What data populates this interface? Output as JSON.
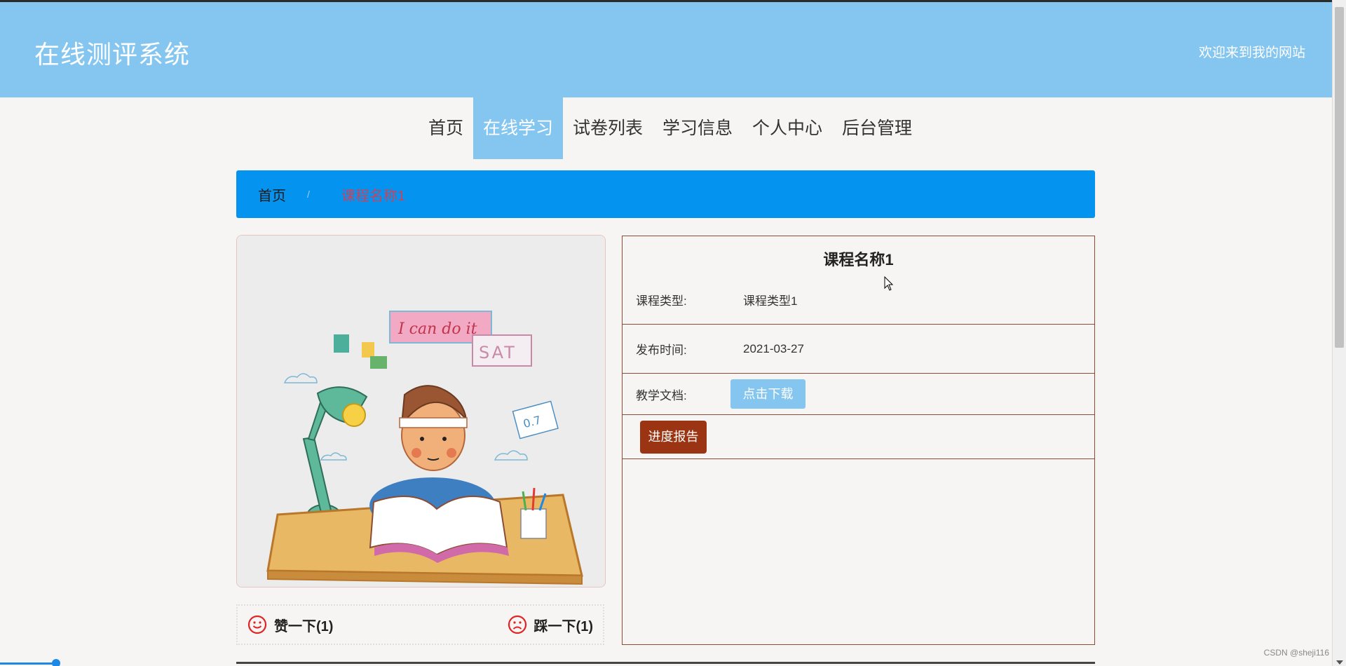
{
  "header": {
    "site_title": "在线测评系统",
    "welcome": "欢迎来到我的网站"
  },
  "nav": {
    "items": [
      {
        "label": "首页",
        "active": false
      },
      {
        "label": "在线学习",
        "active": true
      },
      {
        "label": "试卷列表",
        "active": false
      },
      {
        "label": "学习信息",
        "active": false
      },
      {
        "label": "个人中心",
        "active": false
      },
      {
        "label": "后台管理",
        "active": false
      }
    ]
  },
  "breadcrumb": {
    "home": "首页",
    "separator": "/",
    "current": "课程名称1"
  },
  "image": {
    "banner_text": "I can do it",
    "tag_text": "SAT",
    "paper_text": "0.7"
  },
  "votes": {
    "like": "赞一下(1)",
    "dislike": "踩一下(1)"
  },
  "detail": {
    "title": "课程名称1",
    "type_label": "课程类型:",
    "type_value": "课程类型1",
    "time_label": "发布时间:",
    "time_value": "2021-03-27",
    "doc_label": "教学文档:",
    "download_button": "点击下载",
    "report_button": "进度报告"
  },
  "watermark": "CSDN @sheji116",
  "colors": {
    "header_bg": "#84c6ef",
    "breadcrumb_bg": "#0493ef",
    "report_button": "#9a3412",
    "panel_border": "#8a4c34"
  }
}
